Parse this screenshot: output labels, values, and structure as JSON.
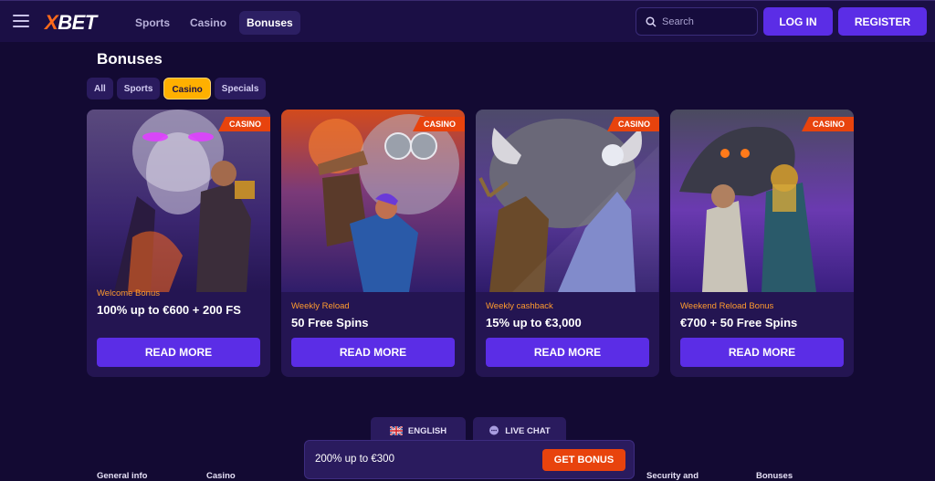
{
  "header": {
    "logo_x": "X",
    "logo_rest": "BET",
    "nav": [
      "Sports",
      "Casino",
      "Bonuses"
    ],
    "active_nav": "Bonuses",
    "search_placeholder": "Search",
    "login_label": "LOG IN",
    "register_label": "REGISTER"
  },
  "page": {
    "title": "Bonuses",
    "filters": [
      "All",
      "Sports",
      "Casino",
      "Specials"
    ],
    "active_filter": "Casino"
  },
  "cards": [
    {
      "badge": "CASINO",
      "subtitle": "Welcome Bonus",
      "title": "100% up to €600 + 200 FS",
      "button": "READ MORE"
    },
    {
      "badge": "CASINO",
      "subtitle": "Weekly Reload",
      "title": "50 Free Spins",
      "button": "READ MORE"
    },
    {
      "badge": "CASINO",
      "subtitle": "Weekly cashback",
      "title": "15% up to €3,000",
      "button": "READ MORE"
    },
    {
      "badge": "CASINO",
      "subtitle": "Weekend Reload Bonus",
      "title": "€700 + 50 Free Spins",
      "button": "READ MORE"
    }
  ],
  "bottom": {
    "language": "ENGLISH",
    "live_chat": "LIVE CHAT",
    "promo_text": "200% up to €300",
    "promo_button": "GET BONUS"
  },
  "footer": {
    "general_info": "General info",
    "casino": "Casino",
    "security": "Security and",
    "bonuses": "Bonuses"
  },
  "colors": {
    "background": "#130a33",
    "accent_purple": "#5b2de6",
    "accent_orange": "#e8430d",
    "active_filter": "#ffb000"
  }
}
